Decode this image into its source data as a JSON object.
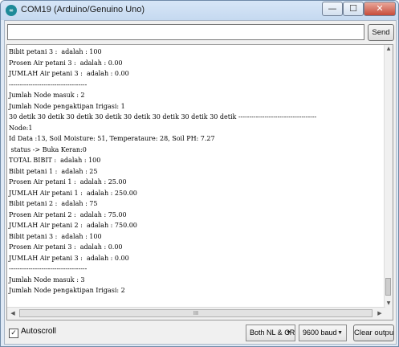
{
  "window": {
    "title": "COM19 (Arduino/Genuino Uno)",
    "icon": "arduino-logo-icon",
    "controls": {
      "minimize": "—",
      "maximize": "☐",
      "close": "✕"
    }
  },
  "send": {
    "input_value": "",
    "button_label": "Send"
  },
  "output_lines": [
    "Bibit petani 3 :  adalah : 100",
    "Prosen Air petani 3 :  adalah : 0.00",
    "JUMLAH Air petani 3 :  adalah : 0.00",
    "------------------------------------",
    "Jumlah Node masuk : 2",
    "Jumlah Node pengaktipan Irigasi: 1",
    "30 detik 30 detik 30 detik 30 detik 30 detik 30 detik 30 detik 30 detik ------------------------------------",
    "Node:1",
    "Id Data :13, Soil Moisture: 51, Temperataure: 28, Soil PH: 7.27",
    " status -> Buka Keran:0",
    "TOTAL BIBIT :  adalah : 100",
    "Bibit petani 1 :  adalah : 25",
    "Prosen Air petani 1 :  adalah : 25.00",
    "JUMLAH Air petani 1 :  adalah : 250.00",
    "Bibit petani 2 :  adalah : 75",
    "Prosen Air petani 2 :  adalah : 75.00",
    "JUMLAH Air petani 2 :  adalah : 750.00",
    "Bibit petani 3 :  adalah : 100",
    "Prosen Air petani 3 :  adalah : 0.00",
    "JUMLAH Air petani 3 :  adalah : 0.00",
    "------------------------------------",
    "Jumlah Node masuk : 3",
    "Jumlah Node pengaktipan Irigasi: 2"
  ],
  "scroll": {
    "hthumb_mark": "III"
  },
  "footer": {
    "autoscroll_label": "Autoscroll",
    "autoscroll_checked": true,
    "line_ending": "Both NL & CR",
    "baud_rate": "9600 baud",
    "clear_label": "Clear output"
  }
}
